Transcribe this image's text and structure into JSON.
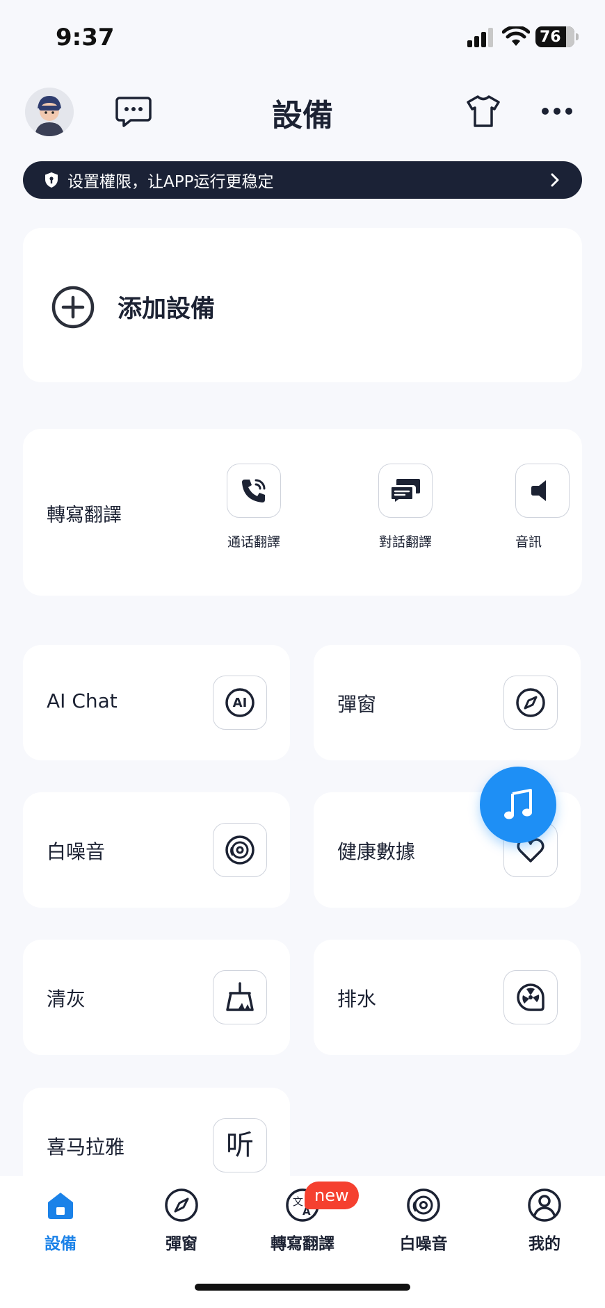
{
  "status": {
    "time": "9:37",
    "battery": "76"
  },
  "header": {
    "title": "設備"
  },
  "permission_banner": {
    "text": "设置權限，让APP运行更稳定"
  },
  "add_device": {
    "label": "添加設備"
  },
  "translation": {
    "label": "轉寫翻譯",
    "items": [
      {
        "label": "通话翻譯",
        "icon": "phone-call-icon"
      },
      {
        "label": "對話翻譯",
        "icon": "chat-bubbles-icon"
      },
      {
        "label": "音訊",
        "icon": "audio-icon"
      }
    ]
  },
  "features": [
    {
      "label": "AI Chat",
      "icon": "ai-icon"
    },
    {
      "label": "彈窗",
      "icon": "compass-icon"
    },
    {
      "label": "白噪音",
      "icon": "disc-icon"
    },
    {
      "label": "健康數據",
      "icon": "heart-icon"
    },
    {
      "label": "清灰",
      "icon": "broom-icon"
    },
    {
      "label": "排水",
      "icon": "drain-icon"
    },
    {
      "label": "喜马拉雅",
      "icon": "listen-icon",
      "icon_text": "听"
    }
  ],
  "ai_icon_text": "AI",
  "tabbar": {
    "items": [
      {
        "label": "設備",
        "icon": "home-icon",
        "active": true
      },
      {
        "label": "彈窗",
        "icon": "compass-icon"
      },
      {
        "label": "轉寫翻譯",
        "icon": "translate-icon"
      },
      {
        "label": "白噪音",
        "icon": "disc-icon"
      },
      {
        "label": "我的",
        "icon": "user-icon"
      }
    ],
    "badge": "new"
  },
  "colors": {
    "accent": "#1b82e8",
    "banner_bg": "#1b2236",
    "fab": "#1e8ff5",
    "badge": "#f5402f"
  }
}
